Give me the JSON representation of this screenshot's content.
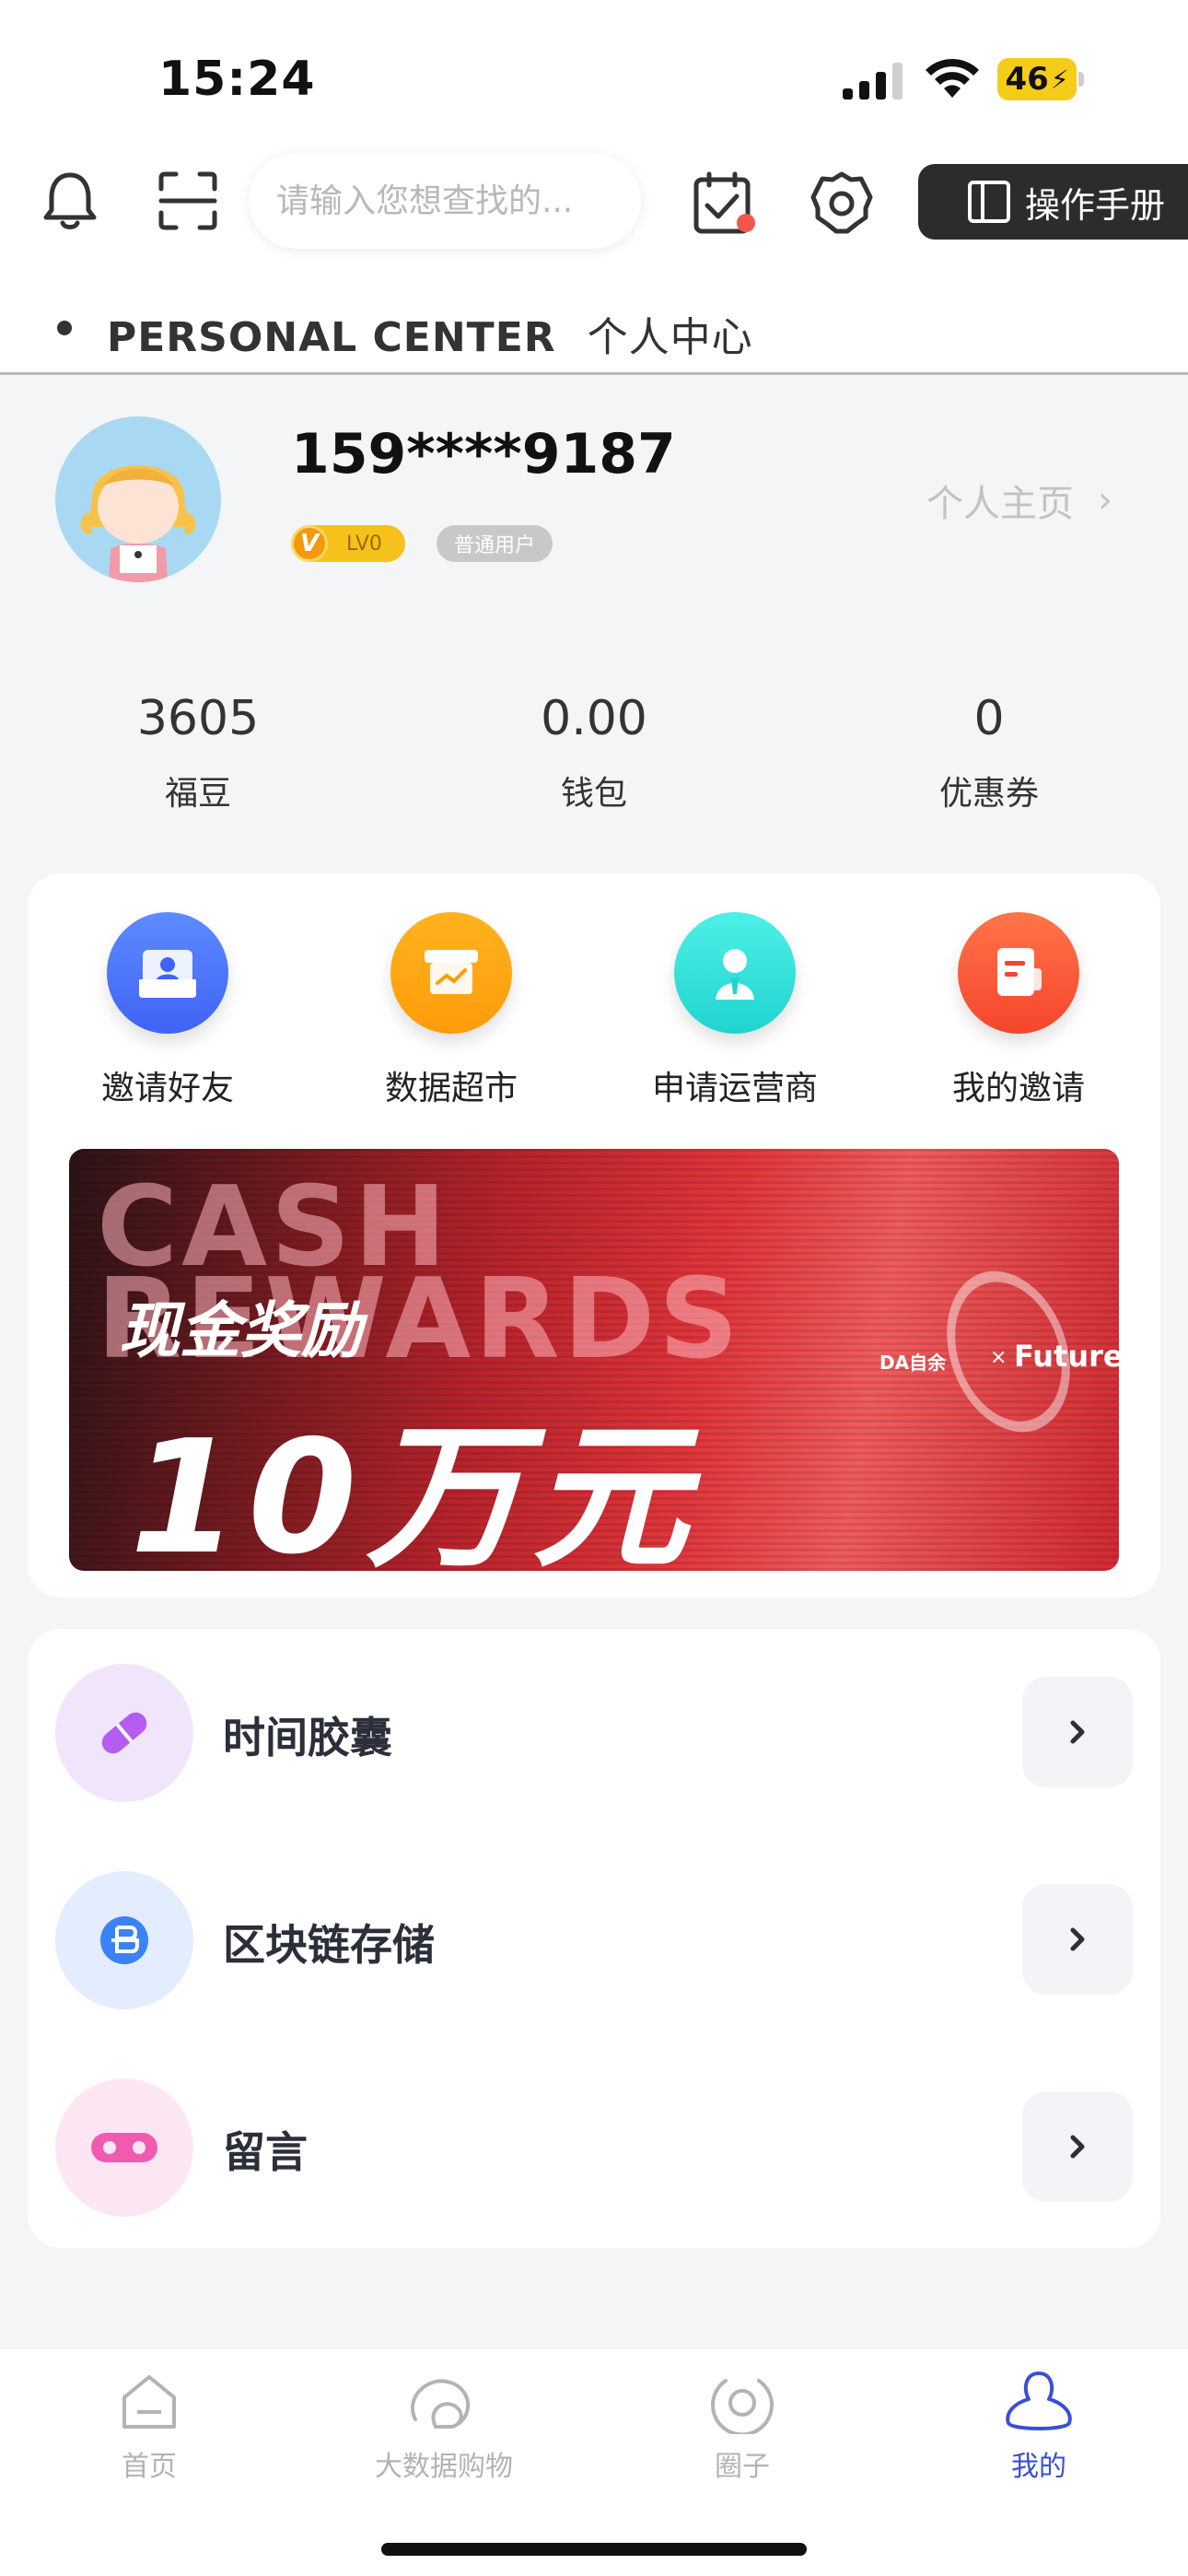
{
  "status_bar": {
    "time": "15:24",
    "battery": "46"
  },
  "toolbar": {
    "search_placeholder": "请输入您想查找的...",
    "manual_label": "操作手册",
    "icons": [
      "bell-icon",
      "scan-icon",
      "calendar-check-icon",
      "settings-icon",
      "book-icon"
    ]
  },
  "section": {
    "title_en": "PERSONAL CENTER",
    "title_cn": "个人中心"
  },
  "profile": {
    "username": "159****9187",
    "level": "LV0",
    "user_type": "普通用户",
    "homepage_label": "个人主页"
  },
  "stats": [
    {
      "value": "3605",
      "label": "福豆"
    },
    {
      "value": "0.00",
      "label": "钱包"
    },
    {
      "value": "0",
      "label": "优惠券"
    }
  ],
  "quick_actions": [
    {
      "label": "邀请好友",
      "icon": "invite-icon",
      "color": "#3f63f5"
    },
    {
      "label": "数据超市",
      "icon": "data-market-icon",
      "color": "#ff9c0a"
    },
    {
      "label": "申请运营商",
      "icon": "operator-icon",
      "color": "#20d4cf"
    },
    {
      "label": "我的邀请",
      "icon": "my-invites-icon",
      "color": "#f5452d"
    }
  ],
  "banner": {
    "ghost_text": "CASH REWARDS",
    "subtitle": "现金奖励",
    "headline": "10万元",
    "brand_left": "DA自余",
    "brand_x": "×",
    "brand_right": "Future"
  },
  "menu": [
    {
      "label": "时间胶囊",
      "icon": "capsule-icon",
      "bg": "#f1e5fb",
      "color": "#b45df0"
    },
    {
      "label": "区块链存储",
      "icon": "blockchain-icon",
      "bg": "#e3edfd",
      "color": "#3b82f6"
    },
    {
      "label": "留言",
      "icon": "voicemail-icon",
      "bg": "#fde6f3",
      "color": "#f05bb1"
    }
  ],
  "tabbar": [
    {
      "label": "首页",
      "icon": "home-icon",
      "active": false
    },
    {
      "label": "大数据购物",
      "icon": "shopping-icon",
      "active": false
    },
    {
      "label": "圈子",
      "icon": "circle-icon",
      "active": false
    },
    {
      "label": "我的",
      "icon": "profile-icon",
      "active": true
    }
  ],
  "colors": {
    "accent": "#3a4fd6",
    "badge_red": "#f4564b",
    "level_gold": "#f7c11b"
  }
}
